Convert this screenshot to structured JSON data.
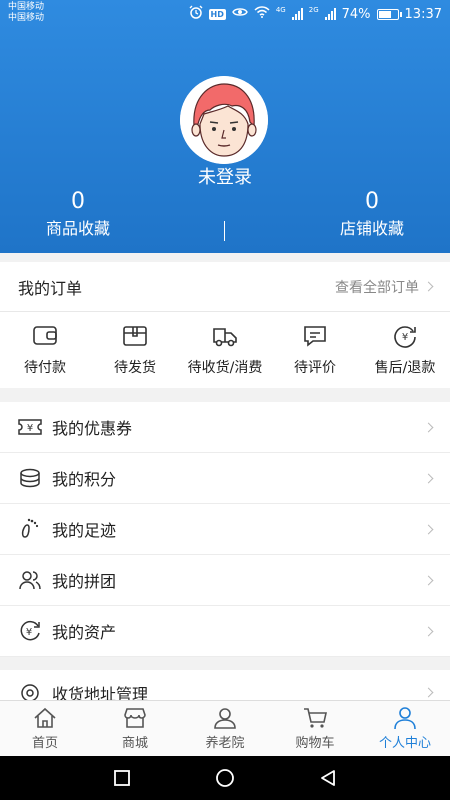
{
  "status_bar": {
    "carrier_line1": "中国移动",
    "carrier_line2": "中国移动",
    "hd_label": "HD",
    "network_label_1": "4G",
    "network_label_2": "2G",
    "battery_percent": "74%",
    "battery_level": 0.74,
    "time": "13:37"
  },
  "profile": {
    "login_text": "未登录",
    "stats": [
      {
        "value": "0",
        "label": "商品收藏"
      },
      {
        "value": "0",
        "label": "店铺收藏"
      }
    ]
  },
  "orders": {
    "title": "我的订单",
    "view_all": "查看全部订单",
    "items": [
      {
        "label": "待付款",
        "icon": "wallet-icon"
      },
      {
        "label": "待发货",
        "icon": "package-icon"
      },
      {
        "label": "待收货/消费",
        "icon": "truck-icon"
      },
      {
        "label": "待评价",
        "icon": "comment-icon"
      },
      {
        "label": "售后/退款",
        "icon": "refund-icon"
      }
    ]
  },
  "menu": [
    {
      "label": "我的优惠券",
      "icon": "coupon-icon"
    },
    {
      "label": "我的积分",
      "icon": "coins-icon"
    },
    {
      "label": "我的足迹",
      "icon": "footprint-icon"
    },
    {
      "label": "我的拼团",
      "icon": "group-icon"
    },
    {
      "label": "我的资产",
      "icon": "assets-icon"
    }
  ],
  "menu2": [
    {
      "label": "收货地址管理",
      "icon": "location-icon"
    }
  ],
  "tabbar": [
    {
      "label": "首页",
      "icon": "home-icon"
    },
    {
      "label": "商城",
      "icon": "store-icon"
    },
    {
      "label": "养老院",
      "icon": "nursing-home-icon"
    },
    {
      "label": "购物车",
      "icon": "cart-icon"
    },
    {
      "label": "个人中心",
      "icon": "person-icon",
      "active": true
    }
  ],
  "colors": {
    "header_top": "#2f8be0",
    "header_bottom": "#1f74c8",
    "active_tab": "#1e7fd8",
    "avatar_hair": "#f26a6a"
  }
}
